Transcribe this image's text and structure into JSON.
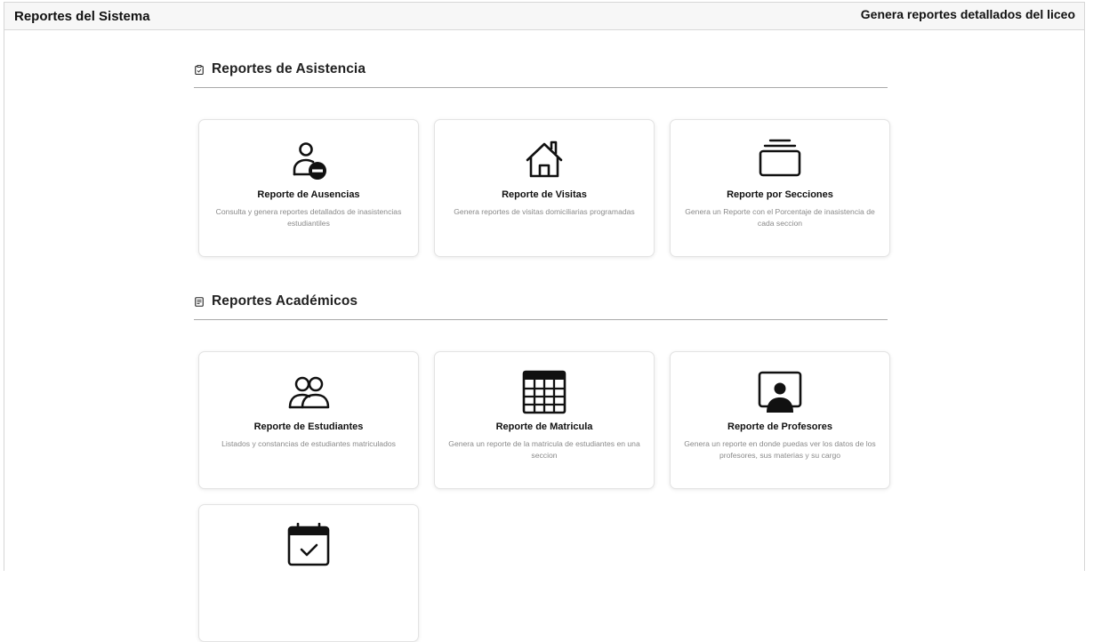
{
  "header": {
    "title": "Reportes del Sistema",
    "subtitle": "Genera reportes detallados del liceo"
  },
  "sections": [
    {
      "title": "Reportes de Asistencia",
      "icon": "clipboard-icon",
      "cards": [
        {
          "title": "Reporte de Ausencias",
          "description": "Consulta y genera reportes detallados de inasistencias estudiantiles",
          "icon": "user-minus-icon"
        },
        {
          "title": "Reporte de Visitas",
          "description": "Genera reportes de visitas domiciliarias programadas",
          "icon": "house-icon"
        },
        {
          "title": "Reporte por Secciones",
          "description": "Genera un Reporte con el Porcentaje de inasistencia de cada seccion",
          "icon": "stack-icon"
        }
      ]
    },
    {
      "title": "Reportes Académicos",
      "icon": "document-icon",
      "cards": [
        {
          "title": "Reporte de Estudiantes",
          "description": "Listados y constancias de estudiantes matriculados",
          "icon": "people-icon"
        },
        {
          "title": "Reporte de Matricula",
          "description": "Genera un reporte de la matricula de estudiantes en una seccion",
          "icon": "table-icon"
        },
        {
          "title": "Reporte de Profesores",
          "description": "Genera un reporte en donde puedas ver los datos de los profesores, sus materias y su cargo",
          "icon": "teacher-board-icon"
        },
        {
          "title": "",
          "description": "",
          "icon": "calendar-check-icon"
        }
      ]
    }
  ]
}
